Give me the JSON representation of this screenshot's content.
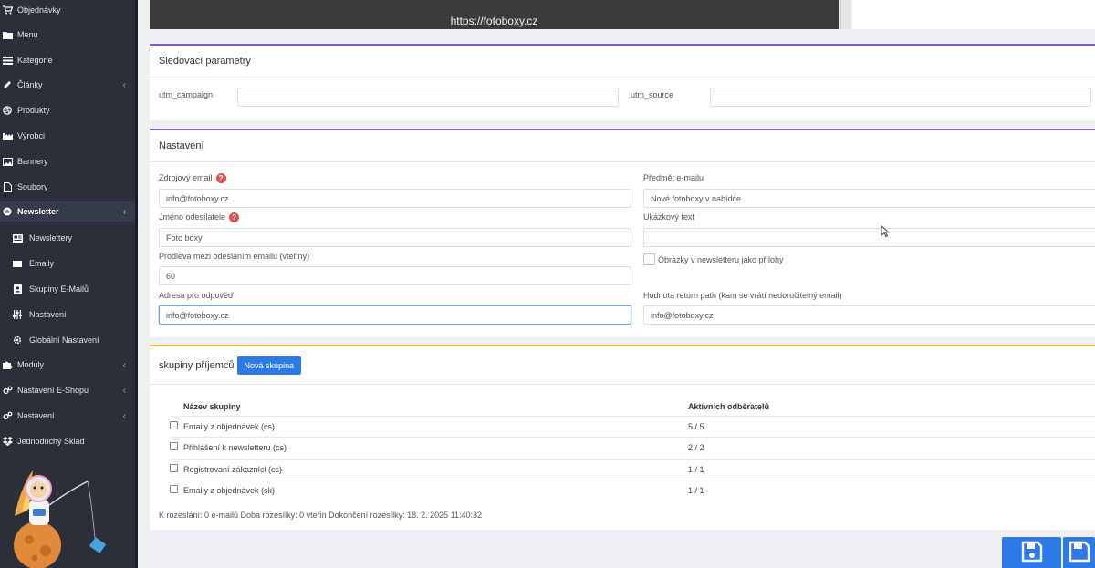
{
  "sidebar": {
    "items": [
      {
        "label": "Objednávky",
        "icon": "cart-icon"
      },
      {
        "label": "Menu",
        "icon": "folder-icon"
      },
      {
        "label": "Kategorie",
        "icon": "list-icon"
      },
      {
        "label": "Články",
        "icon": "pencil-icon"
      },
      {
        "label": "Produkty",
        "icon": "dribbble-icon"
      },
      {
        "label": "Výrobci",
        "icon": "industry-icon"
      },
      {
        "label": "Bannery",
        "icon": "image-icon"
      },
      {
        "label": "Soubory",
        "icon": "file-icon"
      },
      {
        "label": "Newsletter",
        "icon": "envelope-circle-icon"
      },
      {
        "label": "Newslettery",
        "icon": "newspaper-icon"
      },
      {
        "label": "Emaily",
        "icon": "envelope-icon"
      },
      {
        "label": "Skupiny E-Mailů",
        "icon": "address-book-icon"
      },
      {
        "label": "Nastavení",
        "icon": "sliders-icon"
      },
      {
        "label": "Globální Nastavení",
        "icon": "gear-icon"
      },
      {
        "label": "Moduly",
        "icon": "puzzle-icon"
      },
      {
        "label": "Nastavení E-Shopu",
        "icon": "gears-icon"
      },
      {
        "label": "Nastavení",
        "icon": "gears-icon"
      },
      {
        "label": "Jednoduchý Sklad",
        "icon": "dropbox-icon"
      }
    ]
  },
  "preview": {
    "url": "https://fotoboxy.cz"
  },
  "tracking": {
    "title": "Sledovací parametry",
    "utm_campaign_label": "utm_campaign",
    "utm_campaign_value": "",
    "utm_source_label": "utm_source",
    "utm_source_value": ""
  },
  "settings": {
    "title": "Nastavení",
    "source_email_label": "Zdrojový email",
    "source_email_value": "info@fotoboxy.cz",
    "sender_name_label": "Jméno odesílatele",
    "sender_name_value": "Foto boxy",
    "delay_label": "Prodleva mezi odesláním emailu (vteřiny)",
    "delay_value": "60",
    "reply_label": "Adresa pro odpověď",
    "reply_value": "info@fotoboxy.cz",
    "subject_label": "Předmět e-mailu",
    "subject_value": "Nové fotoboxy v nabídce",
    "sample_label": "Ukázkový text",
    "sample_value": "",
    "attachments_label": "Obrázky v newsletteru jako přílohy",
    "return_path_label": "Hodnota return path (kam se vrátí nedoručitelný email)",
    "return_path_value": "info@fotoboxy.cz"
  },
  "groups": {
    "title": "skupiny příjemců",
    "new_button": "Nová skupina",
    "col_name": "Název skupiny",
    "col_active": "Aktivních odběratelů",
    "rows": [
      {
        "name": "Emaily z objednávek (cs)",
        "active": "5 / 5"
      },
      {
        "name": "Přihlášení k newsletteru (cs)",
        "active": "2 / 2"
      },
      {
        "name": "Registrovaní zákazníci (cs)",
        "active": "1 / 1"
      },
      {
        "name": "Emaily z objednávek (sk)",
        "active": "1 / 1"
      }
    ],
    "summary": "K rozeslání: 0 e-mailů Doba rozesílky: 0 vteřin Dokončení rozesílky: 18. 2. 2025 11:40:32"
  },
  "colors": {
    "accent": "#2d7ae6",
    "purple": "#7c5cc4",
    "yellow": "#f0c22b",
    "sidebar": "#2a2f3a",
    "help": "#d9534f"
  }
}
